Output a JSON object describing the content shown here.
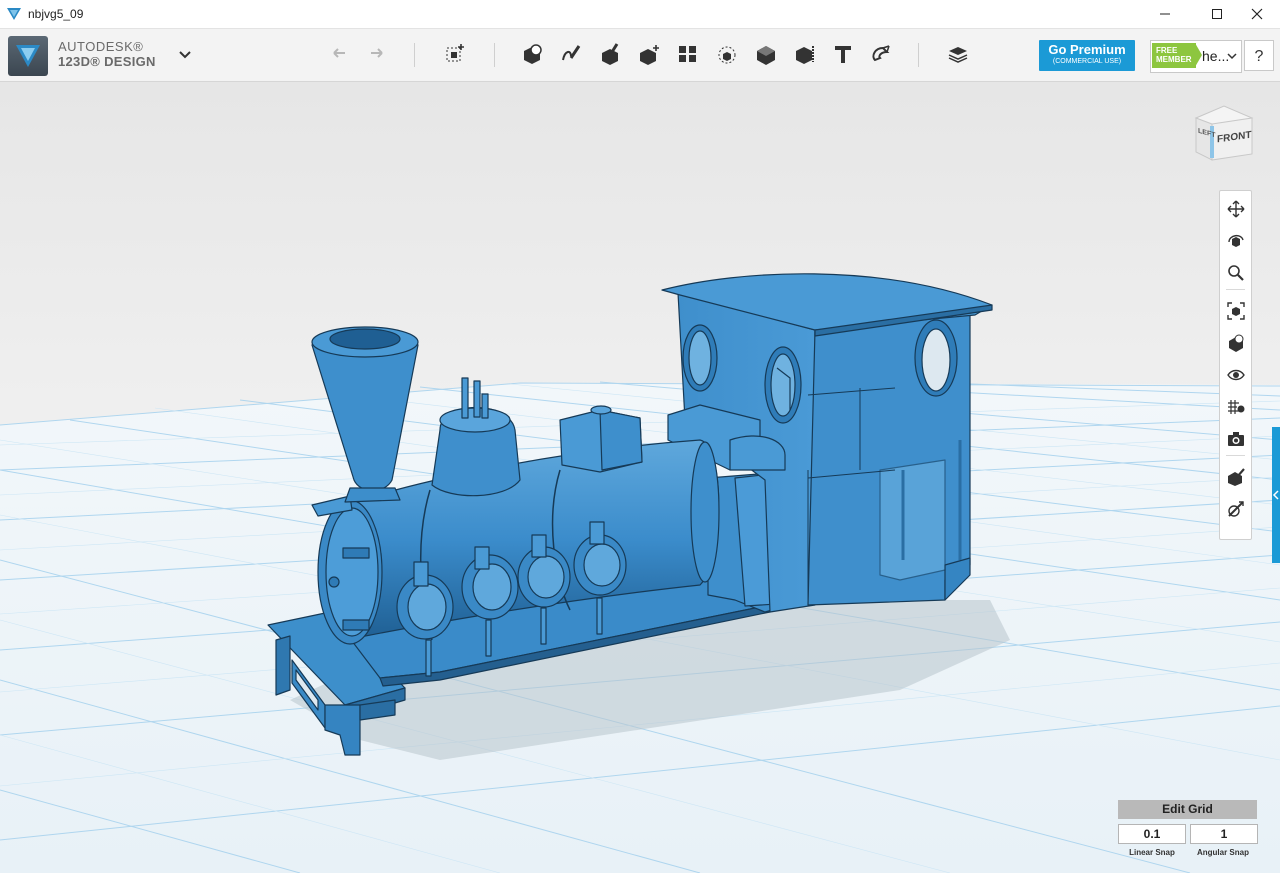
{
  "window": {
    "title": "nbjvg5_09"
  },
  "brand": {
    "top": "AUTODESK®",
    "bottom": "123D® DESIGN"
  },
  "toolbar": {
    "icons": [
      "undo-icon",
      "redo-icon",
      "transform-icon",
      "primitives-icon",
      "sketch-icon",
      "construct-icon",
      "modify-icon",
      "pattern-icon",
      "grouping-icon",
      "combine-icon",
      "measure-icon",
      "text-icon",
      "snap-icon",
      "material-icon"
    ]
  },
  "premium": {
    "title": "Go Premium",
    "subtitle": "(COMMERCIAL USE)"
  },
  "member": {
    "badge_line1": "FREE",
    "badge_line2": "MEMBER",
    "name": "he..."
  },
  "help": {
    "label": "?"
  },
  "viewcube": {
    "left": "LEFT",
    "front": "FRONT"
  },
  "navigation": {
    "icons": [
      "pan-icon",
      "orbit-icon",
      "zoom-icon",
      "fit-icon",
      "view-mode-icon",
      "visibility-icon",
      "grid-material-icon",
      "screenshot-icon",
      "snap-tool-icon",
      "ruler-icon"
    ]
  },
  "grid": {
    "header": "Edit Grid",
    "linear_snap_value": "0.1",
    "angular_snap_value": "1",
    "linear_snap_label": "Linear Snap",
    "angular_snap_label": "Angular Snap"
  },
  "colors": {
    "model": "#3d8fcb",
    "accent": "#1b9ad6",
    "member_green": "#8dc63f"
  }
}
